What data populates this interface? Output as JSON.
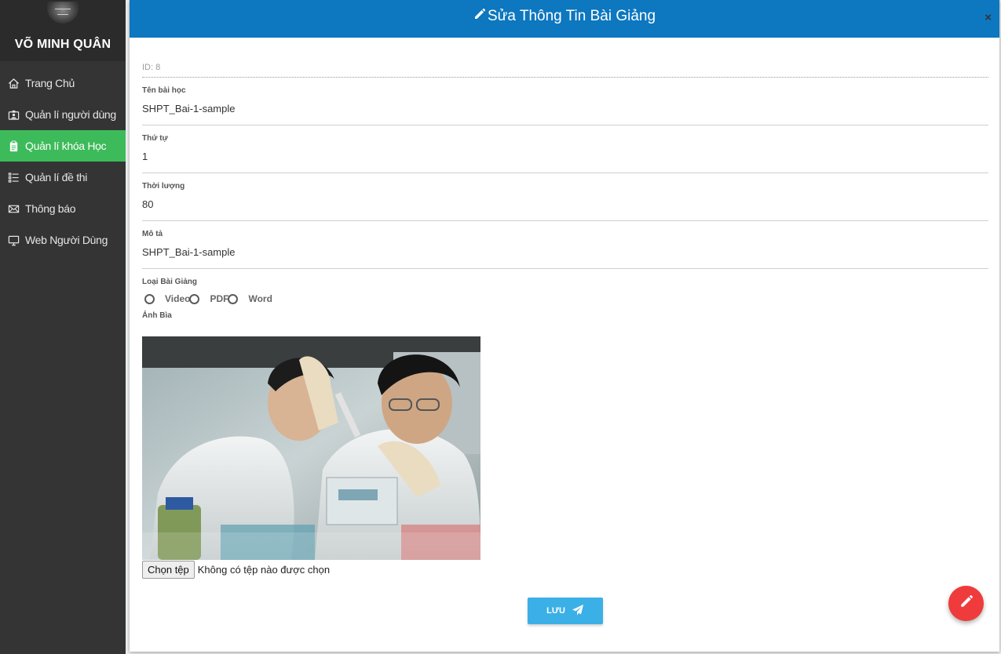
{
  "sidebar": {
    "user_name": "VÕ MINH QUÂN",
    "items": [
      {
        "label": "Trang Chủ",
        "icon": "home-icon",
        "active": false
      },
      {
        "label": "Quản lí người dùng",
        "icon": "user-badge-icon",
        "active": false
      },
      {
        "label": "Quản lí khóa Học",
        "icon": "clipboard-icon",
        "active": true
      },
      {
        "label": "Quản lí đề thi",
        "icon": "list-icon",
        "active": false
      },
      {
        "label": "Thông báo",
        "icon": "envelope-icon",
        "active": false
      },
      {
        "label": "Web Người Dùng",
        "icon": "monitor-icon",
        "active": false
      }
    ],
    "active_color": "#3dba5a"
  },
  "modal": {
    "title": "Sửa Thông Tin Bài Giảng",
    "close_label": "×",
    "header_color": "#0d77bf",
    "id_text": "ID: 8",
    "fields": {
      "lesson_name": {
        "label": "Tên bài học",
        "value": "SHPT_Bai-1-sample"
      },
      "order": {
        "label": "Thứ tự",
        "value": "1"
      },
      "duration": {
        "label": "Thời lượng",
        "value": "80"
      },
      "description": {
        "label": "Mô tả",
        "value": "SHPT_Bai-1-sample"
      }
    },
    "lecture_type": {
      "label": "Loại Bài Giảng",
      "options": [
        "Video",
        "PDF",
        "Word"
      ]
    },
    "cover": {
      "label": "Ảnh Bìa",
      "file_button": "Chọn tệp",
      "file_status": "Không có tệp nào được chọn"
    },
    "save_label": "LƯU",
    "save_color": "#3ab0e6"
  },
  "fab": {
    "icon": "pencil-icon",
    "color": "#ef3b3b"
  }
}
